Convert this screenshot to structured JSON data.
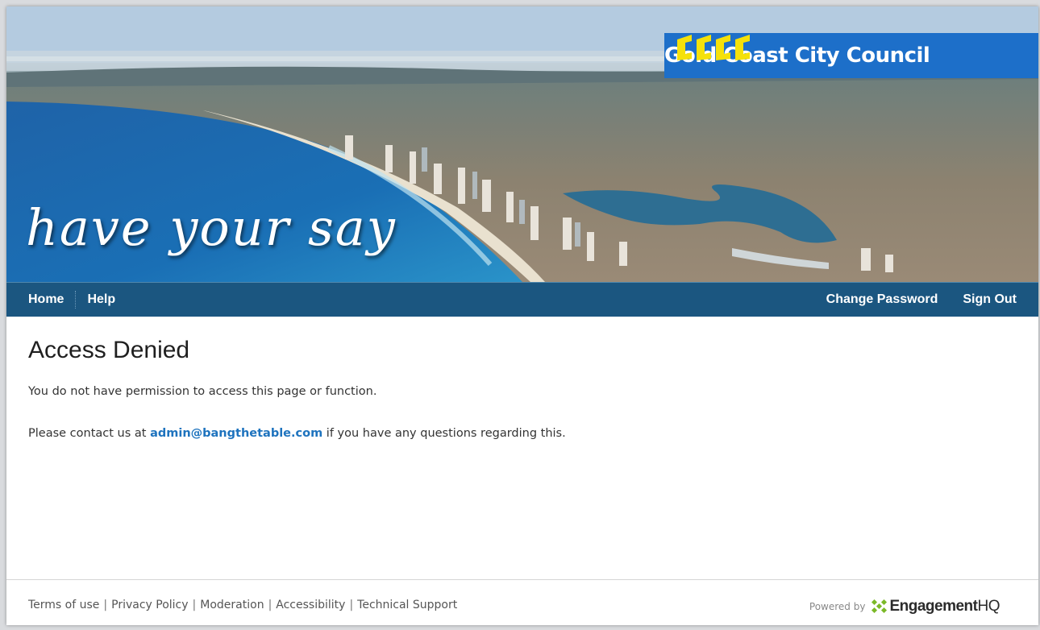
{
  "header": {
    "logo_text": "Gold Coast City Council",
    "tagline": "have your say"
  },
  "nav": {
    "left": [
      {
        "label": "Home"
      },
      {
        "label": "Help"
      }
    ],
    "right": [
      {
        "label": "Change Password"
      },
      {
        "label": "Sign Out"
      }
    ]
  },
  "main": {
    "title": "Access Denied",
    "message": "You do not have permission to access this page or function.",
    "contact_prefix": "Please contact us at",
    "contact_email": "admin@bangthetable.com",
    "contact_suffix": "if you have any questions regarding this."
  },
  "footer": {
    "links": [
      {
        "label": "Terms of use"
      },
      {
        "label": "Privacy Policy"
      },
      {
        "label": "Moderation"
      },
      {
        "label": "Accessibility"
      },
      {
        "label": "Technical Support"
      }
    ],
    "powered_by": "Powered by",
    "brand_main": "Engagement",
    "brand_suffix": "HQ"
  },
  "colors": {
    "nav_bg": "#1b5680",
    "logo_bg": "#1d6fc9",
    "logo_mark": "#f5e10a",
    "link": "#1e73be",
    "brand_icon": "#7bb928"
  }
}
